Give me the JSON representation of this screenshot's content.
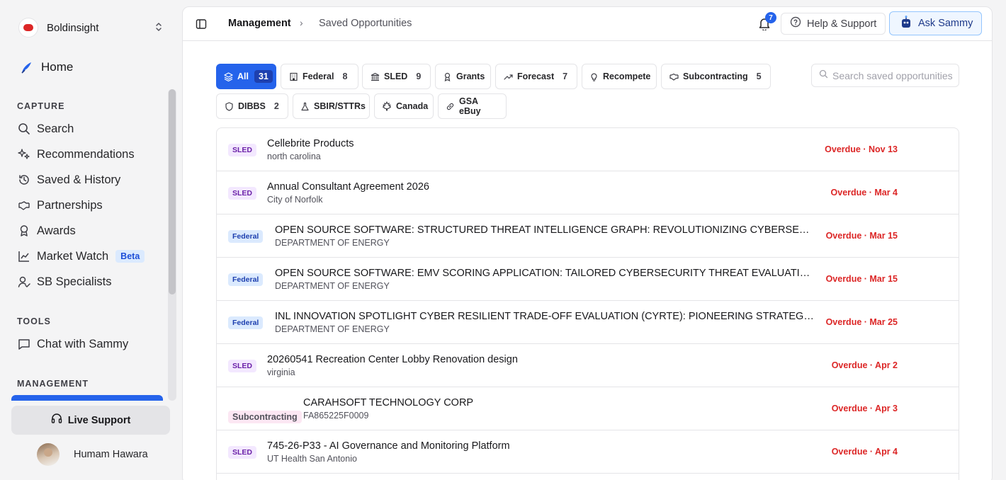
{
  "workspace": {
    "name": "Boldinsight",
    "logo_icon": "boldinsight-logo-icon",
    "switch_icon": "chevron-updown-icon"
  },
  "home": {
    "label": "Home",
    "icon": "home-icon"
  },
  "sections": {
    "capture": "CAPTURE",
    "tools": "TOOLS",
    "management": "MANAGEMENT"
  },
  "capture_items": [
    {
      "label": "Search",
      "icon": "search-icon"
    },
    {
      "label": "Recommendations",
      "icon": "sparkle-icon"
    },
    {
      "label": "Saved & History",
      "icon": "history-icon"
    },
    {
      "label": "Partnerships",
      "icon": "handshake-icon"
    },
    {
      "label": "Awards",
      "icon": "award-icon"
    },
    {
      "label": "Market Watch",
      "icon": "chart-line-icon",
      "badge": "Beta"
    },
    {
      "label": "SB Specialists",
      "icon": "user-check-icon"
    }
  ],
  "tools_items": [
    {
      "label": "Chat with Sammy",
      "icon": "chat-icon"
    }
  ],
  "live_support": {
    "label": "Live Support",
    "icon": "headset-icon"
  },
  "user": {
    "name": "Humam Hawara"
  },
  "breadcrumb": {
    "parent": "Management",
    "separator": "›",
    "current": "Saved Opportunities"
  },
  "notifications": {
    "count": "7"
  },
  "help_button": {
    "label": "Help & Support"
  },
  "ask_button": {
    "label": "Ask Sammy"
  },
  "search": {
    "placeholder": "Search saved opportunities"
  },
  "filters": [
    {
      "label": "All",
      "count": "31",
      "icon": "layers-icon",
      "active": true
    },
    {
      "label": "Federal",
      "count": "8",
      "icon": "building-icon"
    },
    {
      "label": "SLED",
      "count": "9",
      "icon": "landmark-icon"
    },
    {
      "label": "Grants",
      "count": "",
      "icon": "ribbon-icon"
    },
    {
      "label": "Forecast",
      "count": "7",
      "icon": "trend-up-icon"
    },
    {
      "label": "Recompete",
      "count": "",
      "icon": "lightbulb-icon"
    },
    {
      "label": "Subcontracting",
      "count": "5",
      "icon": "handshake-icon"
    },
    {
      "label": "DIBBS",
      "count": "2",
      "icon": "shield-icon"
    },
    {
      "label": "SBIR/STTRs",
      "count": "",
      "icon": "flask-icon"
    },
    {
      "label": "Canada",
      "count": "",
      "icon": "maple-leaf-icon"
    },
    {
      "label": "GSA eBuy",
      "count": "",
      "icon": "link-icon"
    }
  ],
  "opportunities": [
    {
      "tag": "SLED",
      "type": "sled",
      "title": "Cellebrite Products",
      "subtitle": "north carolina",
      "due": "Overdue · Nov 13"
    },
    {
      "tag": "SLED",
      "type": "sled",
      "title": "Annual Consultant Agreement 2026",
      "subtitle": "City of Norfolk",
      "due": "Overdue · Mar 4"
    },
    {
      "tag": "Federal",
      "type": "federal",
      "title": "OPEN SOURCE SOFTWARE: STRUCTURED THREAT INTELLIGENCE GRAPH: REVOLUTIONIZING CYBERSECURITY ANALYSIS",
      "subtitle": "DEPARTMENT OF ENERGY",
      "due": "Overdue · Mar 15"
    },
    {
      "tag": "Federal",
      "type": "federal",
      "title": "OPEN SOURCE SOFTWARE: EMV SCORING APPLICATION: TAILORED CYBERSECURITY THREAT EVALUATION",
      "subtitle": "DEPARTMENT OF ENERGY",
      "due": "Overdue · Mar 15"
    },
    {
      "tag": "Federal",
      "type": "federal",
      "title": "INL INNOVATION SPOTLIGHT CYBER RESILIENT TRADE-OFF EVALUATION (CYRTE): PIONEERING STRATEGY FOR CRITICAL INFRASTRUCTURE",
      "subtitle": "DEPARTMENT OF ENERGY",
      "due": "Overdue · Mar 25"
    },
    {
      "tag": "SLED",
      "type": "sled",
      "title": "20260541 Recreation Center Lobby Renovation design",
      "subtitle": "virginia",
      "due": "Overdue · Apr 2"
    },
    {
      "tag": "Subcontracting",
      "type": "sub",
      "title": "CARAHSOFT TECHNOLOGY CORP",
      "subtitle": "FA865225F0009",
      "due": "Overdue · Apr 3"
    },
    {
      "tag": "SLED",
      "type": "sled",
      "title": "745-26-P33 - AI Governance and Monitoring Platform",
      "subtitle": "UT Health San Antonio",
      "due": "Overdue · Apr 4"
    }
  ]
}
